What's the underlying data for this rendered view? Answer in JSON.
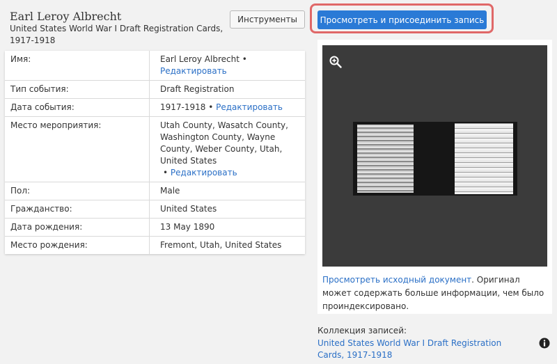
{
  "header": {
    "name": "Earl Leroy Albrecht",
    "collection": "United States World War I Draft Registration Cards, 1917-1918"
  },
  "toolbar": {
    "tools_label": "Инструменты",
    "view_attach_label": "Просмотреть и присоединить запись"
  },
  "record": {
    "edit_label": "Редактировать",
    "rows": [
      {
        "label": "Имя:",
        "value": "Earl Leroy Albrecht",
        "editable": true
      },
      {
        "label": "Тип события:",
        "value": "Draft Registration",
        "editable": false
      },
      {
        "label": "Дата события:",
        "value": "1917-1918",
        "editable": true
      },
      {
        "label": "Место мероприятия:",
        "value": "Utah County, Wasatch County, Washington County, Wayne County, Weber County, Utah, United States",
        "editable": true
      },
      {
        "label": "Пол:",
        "value": "Male",
        "editable": false
      },
      {
        "label": "Гражданство:",
        "value": "United States",
        "editable": false
      },
      {
        "label": "Дата рождения:",
        "value": "13 May 1890",
        "editable": false
      },
      {
        "label": "Место рождения:",
        "value": "Fremont, Utah, United States",
        "editable": false
      }
    ]
  },
  "viewer": {
    "zoom_icon": "zoom-in-icon",
    "link_text": "Просмотреть исходный документ",
    "caption_text": ". Оригинал может содержать больше информации, чем было проиндексировано."
  },
  "collection_section": {
    "label": "Коллекция записей:",
    "link": "United States World War I Draft Registration Cards, 1917-1918",
    "info_icon": "info-icon"
  },
  "colors": {
    "primary": "#2a7ad6",
    "link": "#2a6fc6",
    "highlight": "#e06868"
  }
}
